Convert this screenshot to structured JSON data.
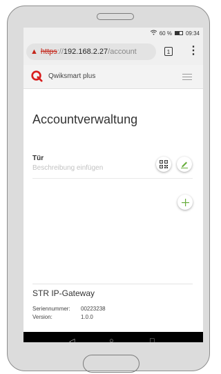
{
  "statusbar": {
    "battery_text": "60 %",
    "time": "09:34"
  },
  "browser": {
    "url_scheme": "https",
    "url_sep": "://",
    "url_host": "192.168.2.27",
    "url_path": "/account",
    "tab_count": "1"
  },
  "app": {
    "name": "Qwiksmart plus",
    "accent_color": "#67ad3b",
    "logo_color": "#d81e1e"
  },
  "page": {
    "title": "Accountverwaltung"
  },
  "item": {
    "title": "Tür",
    "placeholder": "Beschreibung einfügen"
  },
  "gateway": {
    "title": "STR IP-Gateway",
    "serial_label": "Seriennummer:",
    "serial_value": "00223238",
    "version_label": "Version:",
    "version_value": "1.0.0"
  },
  "navbar": {
    "back_glyph": "◁",
    "home_glyph": "○",
    "recents_glyph": "□"
  }
}
